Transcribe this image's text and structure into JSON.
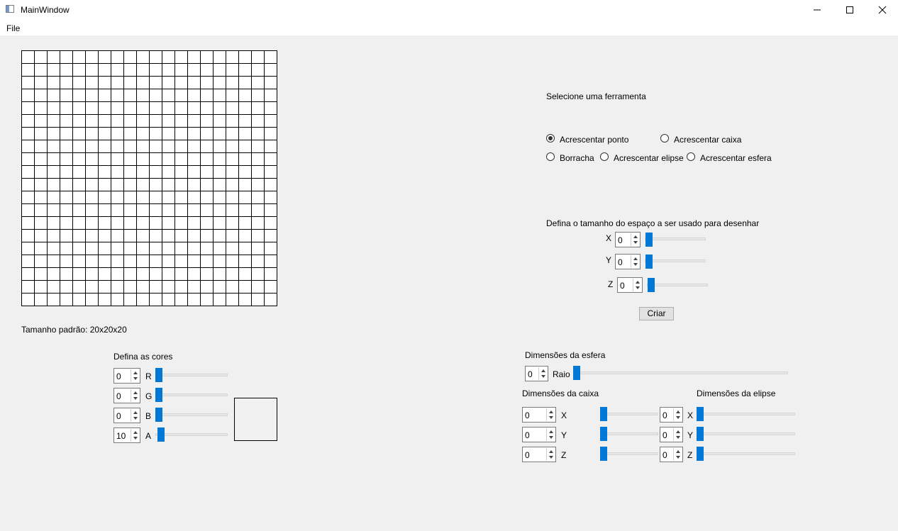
{
  "window": {
    "title": "MainWindow"
  },
  "menu": {
    "file": "File"
  },
  "canvas": {
    "rows": 20,
    "cols": 20
  },
  "default_size": "Tamanho padrão: 20x20x20",
  "tools": {
    "heading": "Selecione uma ferramenta",
    "options": {
      "add_point": "Acrescentar ponto",
      "add_box": "Acrescentar caixa",
      "eraser": "Borracha",
      "add_ellipse": "Acrescentar elipse",
      "add_sphere": "Acrescentar esfera"
    },
    "selected": "add_point"
  },
  "space": {
    "heading": "Defina o tamanho do espaço a ser usado para desenhar",
    "x": {
      "label": "X",
      "value": "0"
    },
    "y": {
      "label": "Y",
      "value": "0"
    },
    "z": {
      "label": "Z",
      "value": "0"
    },
    "create_label": "Criar"
  },
  "colors": {
    "heading": "Defina as cores",
    "r": {
      "label": "R",
      "value": "0"
    },
    "g": {
      "label": "G",
      "value": "0"
    },
    "b": {
      "label": "B",
      "value": "0"
    },
    "a": {
      "label": "A",
      "value": "10"
    }
  },
  "sphere": {
    "heading": "Dimensões da esfera",
    "radius": {
      "label": "Raio",
      "value": "0"
    }
  },
  "box": {
    "heading": "Dimensões da caixa",
    "x": {
      "label": "X",
      "value": "0"
    },
    "y": {
      "label": "Y",
      "value": "0"
    },
    "z": {
      "label": "Z",
      "value": "0"
    }
  },
  "ellipse": {
    "heading": "Dimensões da elipse",
    "x": {
      "label": "X",
      "value": "0"
    },
    "y": {
      "label": "Y",
      "value": "0"
    },
    "z": {
      "label": "Z",
      "value": "0"
    }
  }
}
